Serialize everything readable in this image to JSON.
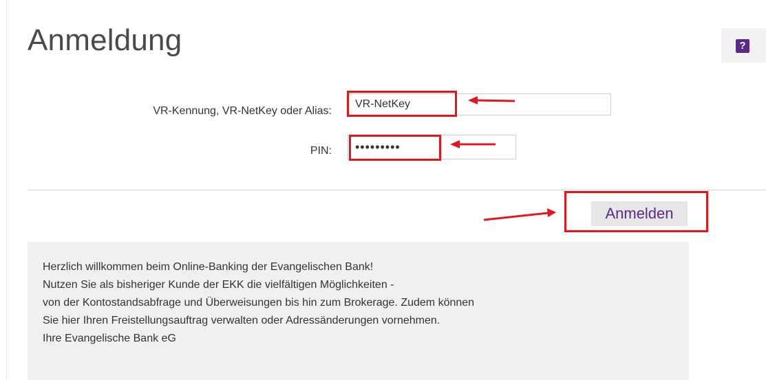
{
  "header": {
    "title": "Anmeldung",
    "help_label": "?"
  },
  "form": {
    "user_label": "VR-Kennung, VR-NetKey oder Alias:",
    "user_value": "VR-NetKey",
    "pin_label": "PIN:",
    "pin_value": "•••••••••",
    "submit_label": "Anmelden"
  },
  "info": {
    "lines": [
      "Herzlich willkommen beim Online-Banking der Evangelischen Bank!",
      "Nutzen Sie als bisheriger Kunde der EKK die vielfältigen Möglichkeiten -",
      "von der Kontostandsabfrage und Überweisungen bis hin zum Brokerage. Zudem können",
      "Sie hier Ihren Freistellungsauftrag verwalten oder Adressänderungen vornehmen.",
      "Ihre Evangelische Bank eG"
    ]
  },
  "colors": {
    "accent": "#5a2a8a",
    "highlight": "#e2161f",
    "info_background": "#f0f0f0"
  },
  "icons": {
    "help": "help-icon",
    "annotation_arrow": "arrow-icon"
  }
}
